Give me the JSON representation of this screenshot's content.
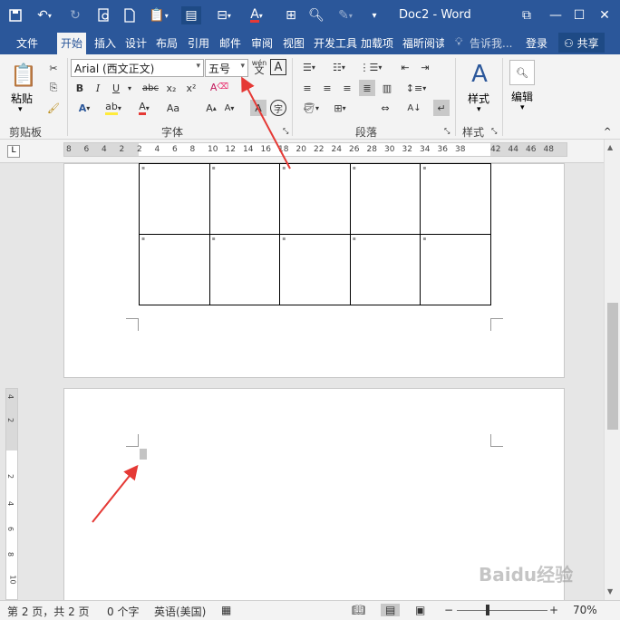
{
  "titlebar": {
    "title": "Doc2 - Word",
    "icons": [
      "save-icon",
      "undo-icon",
      "redo-icon",
      "print-preview-icon",
      "new-document-icon",
      "paste-special-icon",
      "page-view-icon",
      "format-painter-icon",
      "font-color-icon",
      "table-icon",
      "find-icon",
      "highlight-icon",
      "customize-icon",
      "restore-ribbon-icon",
      "minimize-icon",
      "maximize-icon",
      "close-icon"
    ]
  },
  "tabs": {
    "file": "文件",
    "home": "开始",
    "insert": "插入",
    "design": "设计",
    "layout": "布局",
    "references": "引用",
    "mailings": "邮件",
    "review": "审阅",
    "view": "视图",
    "developer": "开发工具",
    "addins": "加载项",
    "foxit": "福昕阅读",
    "tell_me": "告诉我...",
    "login": "登录",
    "share": "共享"
  },
  "ribbon": {
    "clipboard": {
      "paste": "粘贴",
      "label": "剪贴板"
    },
    "font": {
      "font_name": "Arial (西文正文)",
      "font_size": "五号",
      "label": "字体",
      "bold": "B",
      "italic": "I",
      "underline": "U",
      "strike": "abc",
      "subscript": "x₂",
      "superscript": "x²",
      "wen": "wén",
      "A_box": "A"
    },
    "paragraph": {
      "label": "段落"
    },
    "styles": {
      "btn": "样式",
      "label": "样式"
    },
    "editing": {
      "btn": "编辑"
    }
  },
  "ruler": {
    "ticks": [
      "8",
      "6",
      "4",
      "2",
      "2",
      "4",
      "6",
      "8",
      "10",
      "12",
      "14",
      "16",
      "18",
      "20",
      "22",
      "24",
      "26",
      "28",
      "30",
      "32",
      "34",
      "36",
      "38",
      "42",
      "44",
      "46",
      "48"
    ],
    "vticks": [
      "4",
      "2",
      "2",
      "4",
      "6",
      "8",
      "10"
    ]
  },
  "statusbar": {
    "page": "第 2 页，共 2 页",
    "words": "0 个字",
    "language": "英语(美国)",
    "zoom": "70%",
    "minus": "−",
    "plus": "+"
  },
  "watermark": "Baidu经验",
  "colors": {
    "accent": "#2b579a",
    "arrow": "#e53935"
  }
}
